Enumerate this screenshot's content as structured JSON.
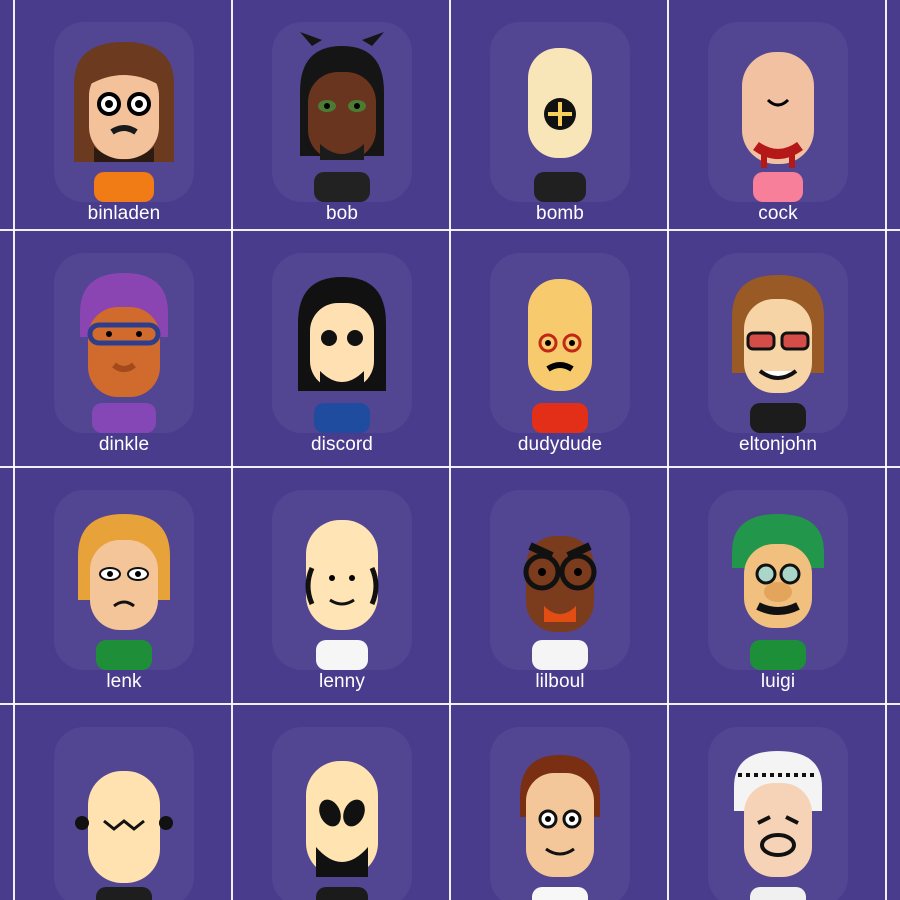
{
  "colors": {
    "background": "#493C8D",
    "grid_line": "#FFFFFF",
    "label_text": "#FFFFFF"
  },
  "grid": {
    "cells": [
      {
        "name": "binladen",
        "icon": "mii-avatar-icon"
      },
      {
        "name": "bob",
        "icon": "mii-avatar-icon"
      },
      {
        "name": "bomb",
        "icon": "mii-avatar-icon"
      },
      {
        "name": "cock",
        "icon": "mii-avatar-icon"
      },
      {
        "name": "dinkle",
        "icon": "mii-avatar-icon"
      },
      {
        "name": "discord",
        "icon": "mii-avatar-icon"
      },
      {
        "name": "dudydude",
        "icon": "mii-avatar-icon"
      },
      {
        "name": "eltonjohn",
        "icon": "mii-avatar-icon"
      },
      {
        "name": "lenk",
        "icon": "mii-avatar-icon"
      },
      {
        "name": "lenny",
        "icon": "mii-avatar-icon"
      },
      {
        "name": "lilboul",
        "icon": "mii-avatar-icon"
      },
      {
        "name": "luigi",
        "icon": "mii-avatar-icon"
      },
      {
        "name": "",
        "icon": "mii-avatar-icon"
      },
      {
        "name": "",
        "icon": "mii-avatar-icon"
      },
      {
        "name": "",
        "icon": "mii-avatar-icon"
      },
      {
        "name": "",
        "icon": "mii-avatar-icon"
      }
    ]
  }
}
